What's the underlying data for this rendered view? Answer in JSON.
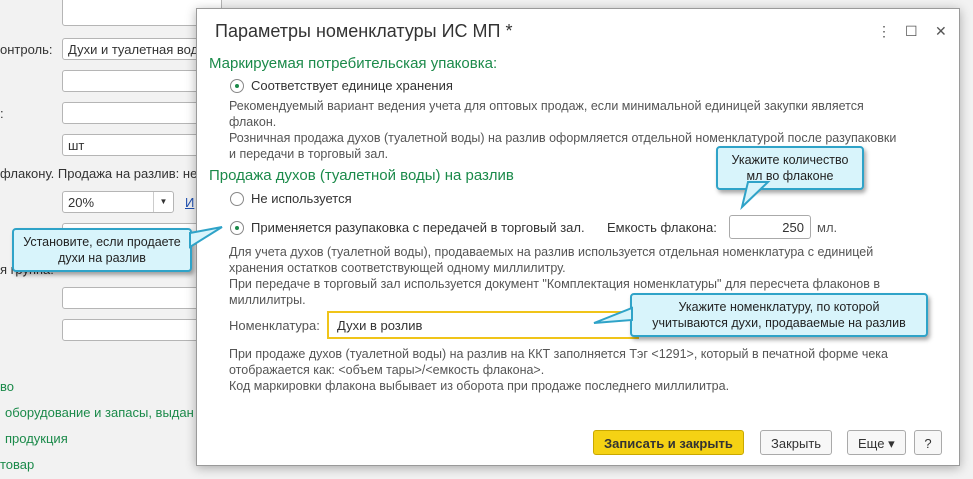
{
  "background": {
    "labels": [
      "онтроль:",
      ":",
      "флакону. Продажа на разлив: не",
      "я группа:"
    ],
    "fields": [
      "",
      "Духи и туалетная вода",
      "",
      "",
      "шт",
      "",
      "",
      ""
    ],
    "vat": "20%",
    "vat_link": "И",
    "links": [
      "во",
      "оборудование и запасы, выдан",
      "продукция",
      "товар"
    ]
  },
  "dialog": {
    "title": "Параметры номенклатуры ИС МП *",
    "window_buttons": [
      "⋮",
      "☐",
      "✕"
    ],
    "section1": {
      "heading": "Маркируемая потребительская упаковка:",
      "option": "Соответствует единице хранения",
      "desc": [
        "Рекомендуемый вариант ведения учета для оптовых продаж, если минимальной единицей закупки является",
        "флакон.",
        "Розничная продажа духов (туалетной воды) на разлив оформляется отдельной номенклатурой после разупаковки",
        "и передачи в торговый зал."
      ]
    },
    "section2": {
      "heading": "Продажа духов (туалетной воды) на разлив",
      "option1": "Не используется",
      "option2": "Применяется разупаковка с передачей в торговый зал.",
      "capacity_label": "Емкость флакона:",
      "capacity_value": "250",
      "capacity_unit": "мл.",
      "desc": [
        "Для учета духов (туалетной воды), продаваемых на разлив используется отдельная номенклатура с единицей",
        "хранения остатков соответствующей одному миллилитру.",
        "При передаче в торговый зал используется документ \"Комплектация номенклатуры\" для пересчета флаконов в",
        "миллилитры."
      ],
      "nomenclature_label": "Номенклатура:",
      "nomenclature_value": "Духи в розлив",
      "footer": [
        "При продаже духов (туалетной воды) на разлив на ККТ заполняется Тэг <1291>, который в печатной форме чека",
        "отображается как: <объем тары>/<емкость флакона>.",
        "Код маркировки флакона выбывает из оборота при продаже последнего миллилитра."
      ]
    },
    "buttons": {
      "save": "Записать и закрыть",
      "close": "Закрыть",
      "more": "Еще ▾",
      "help": "?"
    }
  },
  "callouts": {
    "left": "Установите, если продаете духи на разлив",
    "capacity": "Укажите количество мл во флаконе",
    "nomenclature": "Укажите номенклатуру, по которой учитываются духи, продаваемые на разлив"
  }
}
